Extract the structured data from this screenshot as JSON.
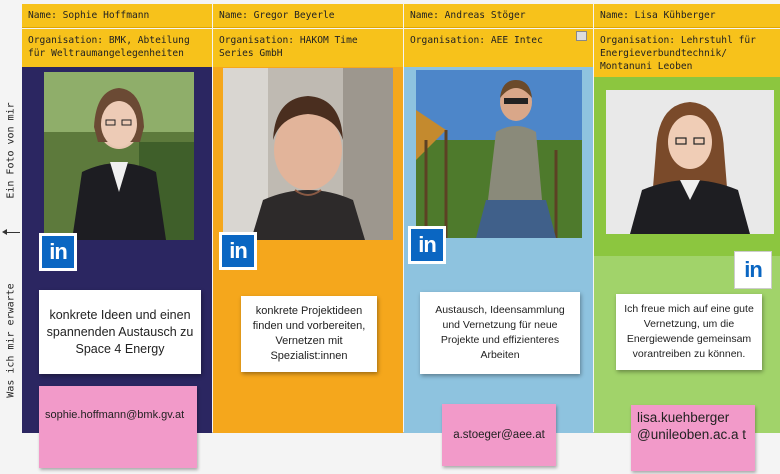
{
  "side_labels": {
    "photo": "Ein Foto von mir",
    "expect": "Was ich mir erwarte"
  },
  "colors": {
    "yellow": "#f7c21b",
    "navy": "#2b2661",
    "orange": "#f5a71c",
    "lightblue": "#8ec3df",
    "green": "#8cc63f",
    "linkedin": "#0a66c2",
    "pink": "#f29ac9"
  },
  "icons": {
    "linkedin": "in"
  },
  "people": [
    {
      "name": "Name: Sophie Hoffmann",
      "org": "Organisation: BMK, Abteilung für Weltraumangelegenheiten",
      "expectation": "konkrete Ideen und einen spannenden Austausch zu Space 4 Energy",
      "email": "sophie.hoffmann@bmk.gv.at"
    },
    {
      "name": "Name: Gregor Beyerle",
      "org": "Organisation: HAKOM Time Series GmbH",
      "expectation": "konkrete Projektideen finden und vorbereiten, Vernetzen mit Spezialist:innen",
      "email": ""
    },
    {
      "name": "Name: Andreas Stöger",
      "org": "Organisation: AEE Intec",
      "expectation": "Austausch, Ideensammlung und Vernetzung für neue Projekte und effizienteres Arbeiten",
      "email": "a.stoeger@aee.at"
    },
    {
      "name": "Name: Lisa Kühberger",
      "org": "Organisation: Lehrstuhl für Energieverbundtechnik/ Montanuni Leoben",
      "expectation": "Ich freue mich auf eine gute Vernetzung, um die Energiewende gemeinsam vorantreiben zu können.",
      "email": "lisa.kuehberger @unileoben.ac.a t"
    }
  ]
}
